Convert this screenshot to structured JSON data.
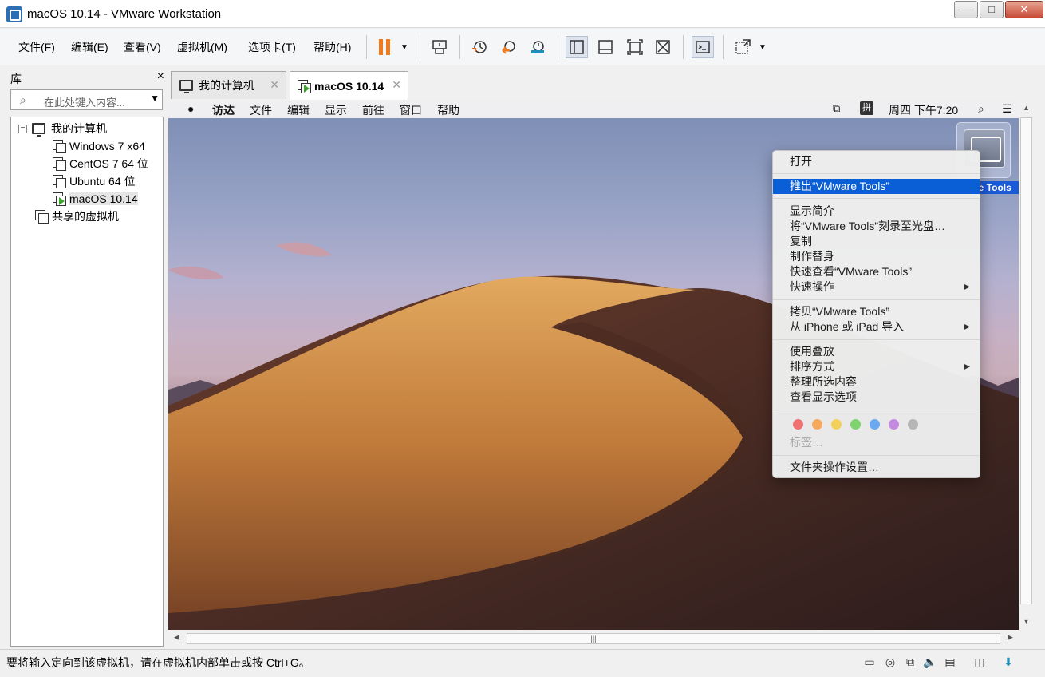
{
  "window": {
    "title": "macOS 10.14 - VMware Workstation",
    "min": "—",
    "max": "□",
    "close": "✕"
  },
  "menubar": {
    "file": "文件(F)",
    "edit": "编辑(E)",
    "view": "查看(V)",
    "vm": "虚拟机(M)",
    "tabs": "选项卡(T)",
    "help": "帮助(H)"
  },
  "library": {
    "title": "库",
    "close": "×",
    "search_placeholder": "在此处键入内容...",
    "root": "我的计算机",
    "vms": [
      "Windows 7 x64",
      "CentOS 7 64 位",
      "Ubuntu 64 位",
      "macOS 10.14"
    ],
    "shared": "共享的虚拟机"
  },
  "tabs": [
    {
      "label": "我的计算机",
      "close": "✕"
    },
    {
      "label": "macOS 10.14",
      "close": "✕"
    }
  ],
  "mac_menubar": {
    "apple": "",
    "items": [
      "访达",
      "文件",
      "编辑",
      "显示",
      "前往",
      "窗口",
      "帮助"
    ],
    "input_method": "拼",
    "clock": "周四 下午7:20"
  },
  "desktop": {
    "drive_label": "re Tools"
  },
  "context_menu": {
    "open": "打开",
    "eject": "推出“VMware Tools”",
    "get_info": "显示简介",
    "burn": "将“VMware Tools”刻录至光盘…",
    "duplicate": "复制",
    "make_alias": "制作替身",
    "quick_look": "快速查看“VMware Tools”",
    "quick_actions": "快速操作",
    "copy": "拷贝“VMware Tools”",
    "import_iphone": "从 iPhone 或 iPad 导入",
    "use_stacks": "使用叠放",
    "sort_by": "排序方式",
    "clean_up": "整理所选内容",
    "view_options": "查看显示选项",
    "tags": "标签…",
    "folder_actions": "文件夹操作设置…",
    "tag_colors": [
      "#f07171",
      "#f5a95e",
      "#f3d05c",
      "#7fd36f",
      "#6aa8f0",
      "#c58ae0",
      "#b6b6b6"
    ]
  },
  "status_bar": {
    "message": "要将输入定向到该虚拟机，请在虚拟机内部单击或按 Ctrl+G。"
  },
  "colors": {
    "accent": "#0a5fd6",
    "pause": "#f07a1e",
    "vm_running": "#3aa32a"
  }
}
